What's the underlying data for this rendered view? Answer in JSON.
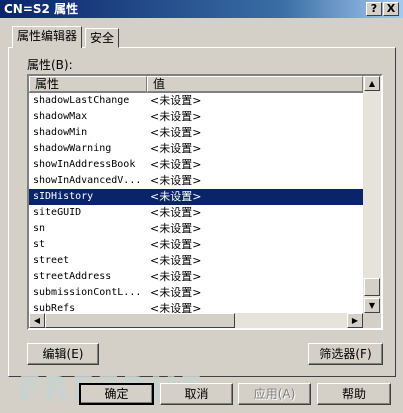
{
  "window": {
    "title": "CN=S2 属性",
    "help_button": "?",
    "close_button": "X"
  },
  "tabs": [
    {
      "label": "属性编辑器",
      "active": true
    },
    {
      "label": "安全",
      "active": false
    }
  ],
  "attributes_label": "属性(B):",
  "table": {
    "columns": [
      "属性",
      "值"
    ],
    "rows": [
      {
        "name": "shadowLastChange",
        "value": "<未设置>"
      },
      {
        "name": "shadowMax",
        "value": "<未设置>"
      },
      {
        "name": "shadowMin",
        "value": "<未设置>"
      },
      {
        "name": "shadowWarning",
        "value": "<未设置>"
      },
      {
        "name": "showInAddressBook",
        "value": "<未设置>"
      },
      {
        "name": "showInAdvancedV...",
        "value": "<未设置>"
      },
      {
        "name": "sIDHistory",
        "value": "<未设置>",
        "selected": true
      },
      {
        "name": "siteGUID",
        "value": "<未设置>"
      },
      {
        "name": "sn",
        "value": "<未设置>"
      },
      {
        "name": "st",
        "value": "<未设置>"
      },
      {
        "name": "street",
        "value": "<未设置>"
      },
      {
        "name": "streetAddress",
        "value": "<未设置>"
      },
      {
        "name": "submissionContL...",
        "value": "<未设置>"
      },
      {
        "name": "subRefs",
        "value": "<未设置>"
      }
    ]
  },
  "buttons": {
    "edit": "编辑(E)",
    "filter": "筛选器(F)",
    "ok": "确定",
    "cancel": "取消",
    "apply": "应用(A)",
    "help": "帮助"
  },
  "scroll_arrows": {
    "up": "▲",
    "down": "▼",
    "left": "◀",
    "right": "▶"
  },
  "watermark": "FREEBUF"
}
